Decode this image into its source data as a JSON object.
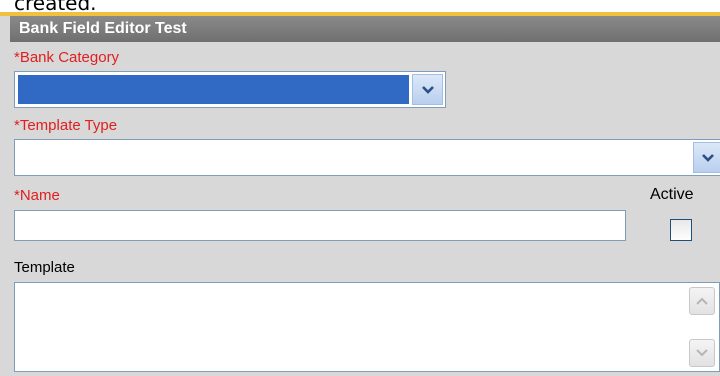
{
  "top_partial_text": "created.",
  "header": {
    "title": "Bank Field Editor Test"
  },
  "fields": {
    "bank_category": {
      "label": "*Bank Category",
      "value": ""
    },
    "template_type": {
      "label": "*Template Type",
      "value": ""
    },
    "name": {
      "label": "*Name",
      "value": ""
    },
    "active": {
      "label": "Active",
      "checked": false
    },
    "template": {
      "label": "Template",
      "value": ""
    }
  },
  "colors": {
    "required_label": "#e02020",
    "header_bg": "#777777",
    "selected_fill": "#316ac5"
  },
  "icons": {
    "dropdown": "chevron-down-icon",
    "scroll_up": "chevron-up-icon",
    "scroll_down": "chevron-down-icon"
  }
}
